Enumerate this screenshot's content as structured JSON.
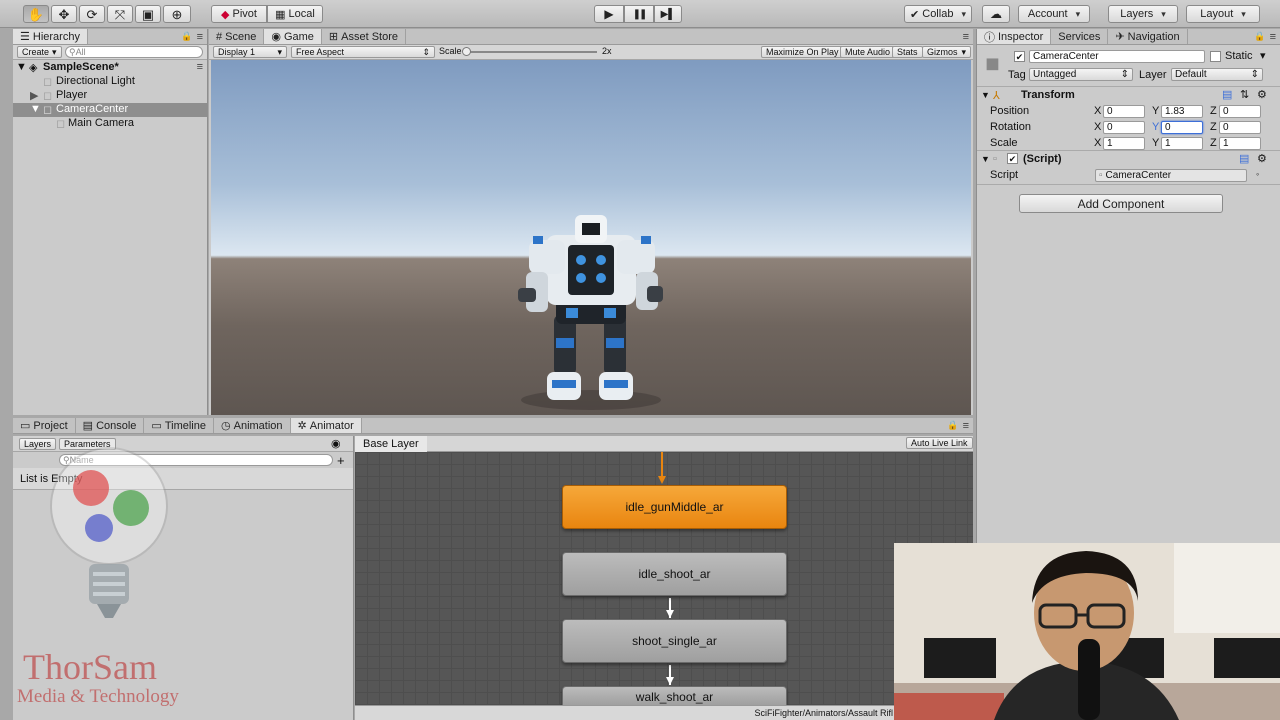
{
  "toolbar": {
    "tool_icons": [
      "hand-icon",
      "move-icon",
      "rotate-icon",
      "scale-icon",
      "rect-icon",
      "transform-icon"
    ],
    "pivot_label": "Pivot",
    "local_label": "Local",
    "play_icon": "▶",
    "pause_icon": "❚❚",
    "step_icon": "▶▌",
    "collab_label": "Collab",
    "account_label": "Account",
    "layers_label": "Layers",
    "layout_label": "Layout"
  },
  "hierarchy": {
    "tab": "Hierarchy",
    "create_label": "Create",
    "search_placeholder": "All",
    "scene": "SampleScene*",
    "items": [
      "Directional Light",
      "Player",
      "CameraCenter",
      "Main Camera"
    ]
  },
  "scene_tabs": {
    "scene": "Scene",
    "game": "Game",
    "asset_store": "Asset Store"
  },
  "game_bar": {
    "display": "Display 1",
    "aspect": "Free Aspect",
    "scale_label": "Scale",
    "scale_value": "2x",
    "maximize": "Maximize On Play",
    "mute": "Mute Audio",
    "stats": "Stats",
    "gizmos": "Gizmos"
  },
  "inspector": {
    "tabs": {
      "inspector": "Inspector",
      "services": "Services",
      "navigation": "Navigation"
    },
    "object_name": "CameraCenter",
    "static_label": "Static",
    "tag_label": "Tag",
    "tag_value": "Untagged",
    "layer_label": "Layer",
    "layer_value": "Default",
    "transform_title": "Transform",
    "position_label": "Position",
    "rotation_label": "Rotation",
    "scale_label": "Scale",
    "axis": {
      "x": "X",
      "y": "Y",
      "z": "Z"
    },
    "position": {
      "x": "0",
      "y": "1.83",
      "z": "0"
    },
    "rotation": {
      "x": "0",
      "y": "0",
      "z": "0"
    },
    "scale": {
      "x": "1",
      "y": "1",
      "z": "1"
    },
    "script_title": "(Script)",
    "script_label": "Script",
    "script_value": "CameraCenter",
    "add_component": "Add Component"
  },
  "bottom_tabs": {
    "project": "Project",
    "console": "Console",
    "timeline": "Timeline",
    "animation": "Animation",
    "animator": "Animator"
  },
  "animator": {
    "layers_tab": "Layers",
    "parameters_tab": "Parameters",
    "search_placeholder": "Name",
    "empty_text": "List is Empty",
    "base_layer": "Base Layer",
    "auto_live": "Auto Live Link",
    "nodes": [
      "idle_gunMiddle_ar",
      "idle_shoot_ar",
      "shoot_single_ar",
      "walk_shoot_ar"
    ],
    "path": "SciFiFighter/Animators/Assault Rifl"
  },
  "watermark": {
    "line1": "ThorSam",
    "line2": "Media & Technology"
  },
  "colors": {
    "accent": "#3d6fd8",
    "state_default": "#ef9420"
  }
}
